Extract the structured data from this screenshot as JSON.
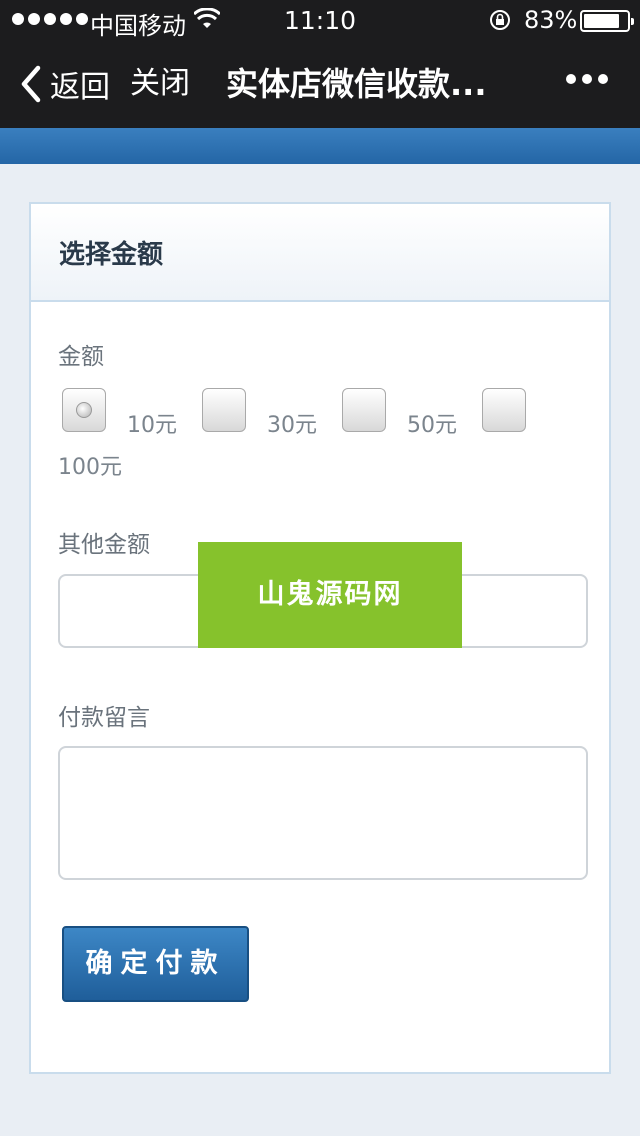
{
  "status_bar": {
    "carrier": "中国移动",
    "time": "11:10",
    "battery_percent": "83%",
    "battery_level": 0.83
  },
  "nav": {
    "back_label": "返回",
    "close_label": "关闭",
    "title": "实体店微信收款..."
  },
  "panel": {
    "title": "选择金额",
    "amount_label": "金额",
    "options": [
      {
        "label": "10元",
        "selected": true
      },
      {
        "label": "30元",
        "selected": false
      },
      {
        "label": "50元",
        "selected": false
      },
      {
        "label": "100元",
        "selected": false
      }
    ],
    "other_amount_label": "其他金额",
    "other_amount_value": "",
    "message_label": "付款留言",
    "message_value": "",
    "submit_label": "确定付款"
  },
  "watermark": "山鬼源码网",
  "colors": {
    "nav_bg": "#1c1c1e",
    "accent_blue": "#2466a6",
    "watermark_green": "#86c22c"
  }
}
